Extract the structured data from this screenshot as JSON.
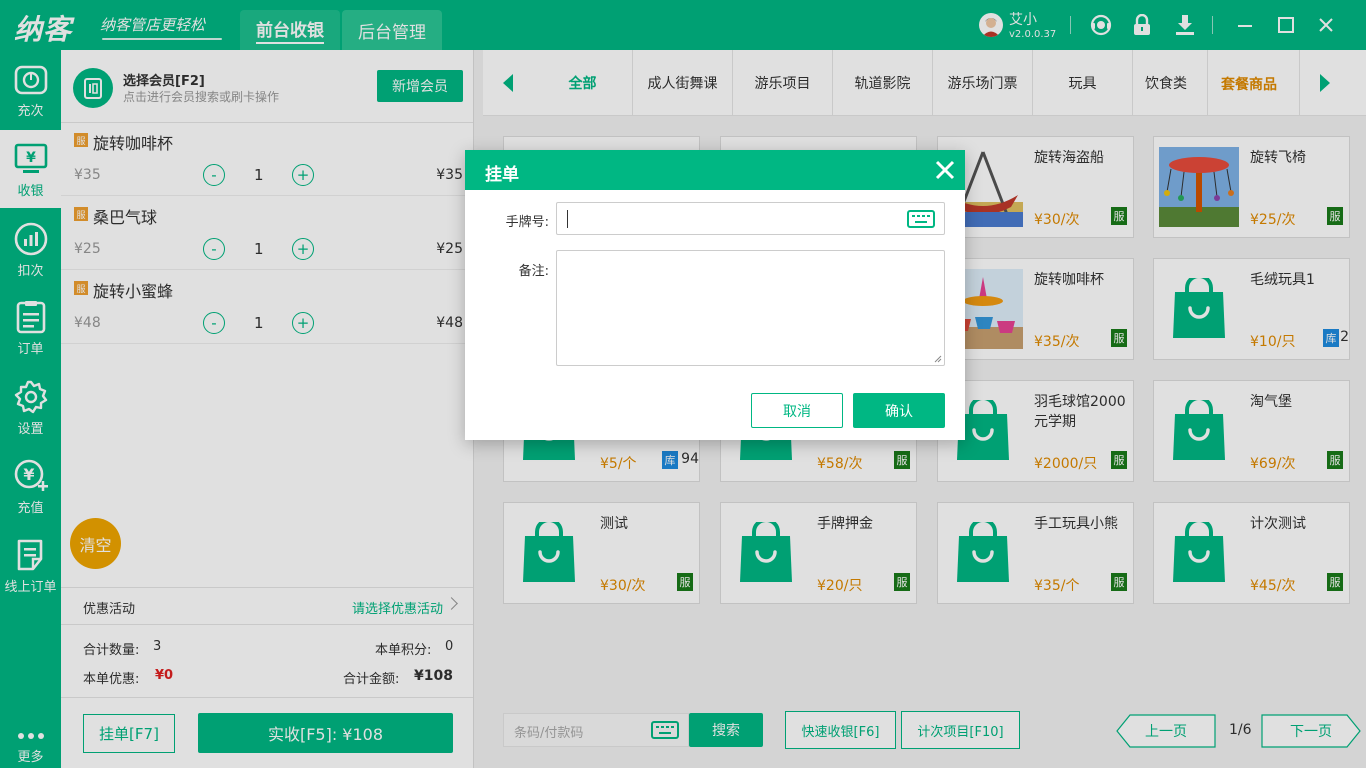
{
  "app": {
    "logo": "纳客",
    "slogan": "纳客管店更轻松",
    "tabs": [
      "前台收银",
      "后台管理"
    ],
    "user": {
      "name": "艾小",
      "version": "v2.0.0.37"
    }
  },
  "sidebar": {
    "items": [
      {
        "label": "充次",
        "icon": "recharge-times-icon"
      },
      {
        "label": "收银",
        "icon": "cashier-icon"
      },
      {
        "label": "扣次",
        "icon": "deduct-times-icon"
      },
      {
        "label": "订单",
        "icon": "order-icon"
      },
      {
        "label": "设置",
        "icon": "settings-gear-icon"
      },
      {
        "label": "充值",
        "icon": "recharge-money-icon"
      },
      {
        "label": "线上订单",
        "icon": "online-order-icon"
      },
      {
        "label": "更多",
        "icon": "more-dots-icon"
      }
    ],
    "active_index": 1
  },
  "member": {
    "title": "选择会员[F2]",
    "hint": "点击进行会员搜索或刷卡操作",
    "add_button": "新增会员"
  },
  "order": {
    "items": [
      {
        "tag": "服",
        "name": "旋转咖啡杯",
        "price": "¥35",
        "qty": "1",
        "total": "¥35"
      },
      {
        "tag": "服",
        "name": "桑巴气球",
        "price": "¥25",
        "qty": "1",
        "total": "¥25"
      },
      {
        "tag": "服",
        "name": "旋转小蜜蜂",
        "price": "¥48",
        "qty": "1",
        "total": "¥48"
      }
    ],
    "minus": "-",
    "plus": "+",
    "clear": "清空",
    "promo_label": "优惠活动",
    "promo_select": "请选择优惠活动",
    "total_qty_label": "合计数量:",
    "total_qty": "3",
    "points_label": "本单积分:",
    "points": "0",
    "discount_label": "本单优惠:",
    "discount": "¥0",
    "total_amount_label": "合计金额:",
    "total_amount": "¥108",
    "hold_button": "挂单[F7]",
    "pay_button": "实收[F5]: ¥108"
  },
  "categories": {
    "items": [
      "全部",
      "成人街舞课",
      "游乐项目",
      "轨道影院",
      "游乐场门票",
      "玩具",
      "饮食类"
    ],
    "active_index": 0,
    "combo": "套餐商品"
  },
  "products": [
    {
      "name": "",
      "price": "",
      "badge": ""
    },
    {
      "name": "",
      "price": "",
      "badge": ""
    },
    {
      "name": "旋转海盗船",
      "price": "¥30/次",
      "badge": "服",
      "image": "pirate-ship-photo"
    },
    {
      "name": "旋转飞椅",
      "price": "¥25/次",
      "badge": "服",
      "image": "swing-ride-photo"
    },
    {
      "name": "",
      "price": "",
      "badge": ""
    },
    {
      "name": "",
      "price": "",
      "badge": ""
    },
    {
      "name": "旋转咖啡杯",
      "price": "¥35/次",
      "badge": "服",
      "image": "teacup-ride-photo"
    },
    {
      "name": "毛绒玩具1",
      "price": "¥10/只",
      "badge": "库",
      "stock": "2",
      "image": "bag-icon"
    },
    {
      "name": "",
      "price": "¥5/个",
      "badge": "库",
      "stock": "94",
      "image": "bag-icon"
    },
    {
      "name": "",
      "price": "¥58/次",
      "badge": "服",
      "image": "bag-icon"
    },
    {
      "name": "羽毛球馆2000元学期",
      "price": "¥2000/只",
      "badge": "服",
      "image": "bag-icon"
    },
    {
      "name": "淘气堡",
      "price": "¥69/次",
      "badge": "服",
      "image": "bag-icon"
    },
    {
      "name": "测试",
      "price": "¥30/次",
      "badge": "服",
      "image": "bag-icon"
    },
    {
      "name": "手牌押金",
      "price": "¥20/只",
      "badge": "服",
      "image": "bag-icon"
    },
    {
      "name": "手工玩具小熊",
      "price": "¥35/个",
      "badge": "服",
      "image": "bag-icon"
    },
    {
      "name": "计次测试",
      "price": "¥45/次",
      "badge": "服",
      "image": "bag-icon"
    }
  ],
  "bottom": {
    "search_placeholder": "条码/付款码",
    "search_button": "搜索",
    "quick_cashier": "快速收银[F6]",
    "count_items": "计次项目[F10]",
    "prev_page": "上一页",
    "page": "1/6",
    "next_page": "下一页"
  },
  "modal": {
    "title": "挂单",
    "tag_label": "手牌号:",
    "tag_value": "",
    "remark_label": "备注:",
    "remark_value": "",
    "cancel": "取消",
    "confirm": "确认"
  },
  "colors": {
    "accent": "#00b783",
    "orange": "#e08a00",
    "discount_red": "#e02020"
  }
}
